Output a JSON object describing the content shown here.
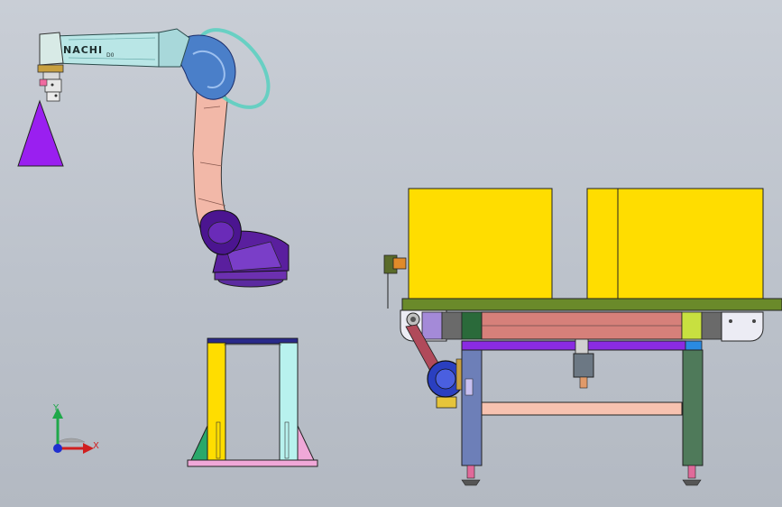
{
  "robot": {
    "brand_label": "NACHI",
    "model_suffix": "D0"
  },
  "triad": {
    "y_label": "Y",
    "x_label": "X"
  },
  "colors": {
    "background": "#c2c7cf",
    "robot_arm": "#b9e6e6",
    "robot_joint": "#4a7fc9",
    "robot_link": "#f2b8a8",
    "robot_base": "#5a1f9e",
    "tool_cone": "#9a1ff0",
    "box_yellow": "#ffdd00",
    "conveyor_top": "#6a8a2a",
    "conveyor_beam": "#d6807a",
    "frame_purple": "#8a2be2",
    "leg_blue": "#6d7fb8",
    "leg_green": "#4f7a5a",
    "stand_cyan": "#b8f2ee",
    "stand_pink": "#f0a8d8",
    "motor_blue": "#2a3fc0"
  }
}
